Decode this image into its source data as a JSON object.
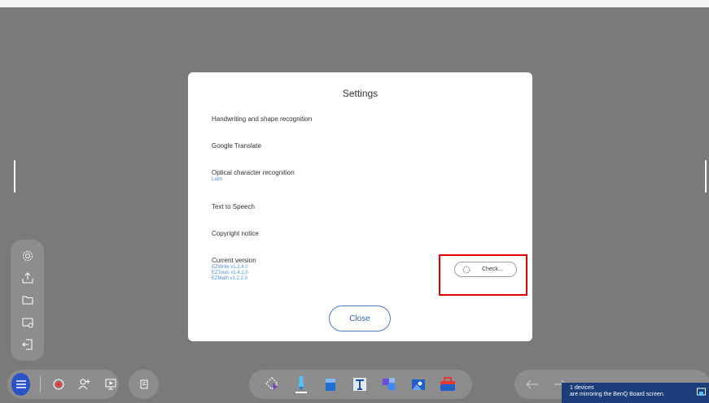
{
  "dialog": {
    "title": "Settings",
    "items": [
      {
        "label": "Handwriting and shape recognition"
      },
      {
        "label": "Google Translate"
      },
      {
        "label": "Optical character recognition",
        "sub": "Latin"
      },
      {
        "label": "Text to Speech"
      },
      {
        "label": "Copyright notice"
      }
    ],
    "version": {
      "label": "Current version",
      "lines": [
        "EZWrite v1.2.4.0",
        "EZTools v1.4.2.0",
        "EZMath v1.2.2.0"
      ]
    },
    "check_label": "Check...",
    "close_label": "Close"
  },
  "side_menu": {
    "icons": [
      "settings-icon",
      "export-icon",
      "folder-icon",
      "screen-save-icon",
      "exit-icon"
    ]
  },
  "toolbar_left": {
    "icons": [
      "menu-icon",
      "record-icon",
      "add-user-icon",
      "present-icon"
    ]
  },
  "toolbar_center": {
    "icons": [
      "lasso-select-icon",
      "pen-icon",
      "eraser-icon",
      "text-icon",
      "shapes-icon",
      "image-icon",
      "toolbox-icon"
    ]
  },
  "toolbar_right": {
    "icons": [
      "undo-icon",
      "redo-icon"
    ]
  },
  "toast": {
    "line1": "1 devices",
    "line2": "are mirroring the BenQ Board screen."
  },
  "colors": {
    "accent": "#2a54c6",
    "link": "#4a90e2",
    "highlight": "#e00000",
    "toast_bg": "#1b3e7a"
  }
}
